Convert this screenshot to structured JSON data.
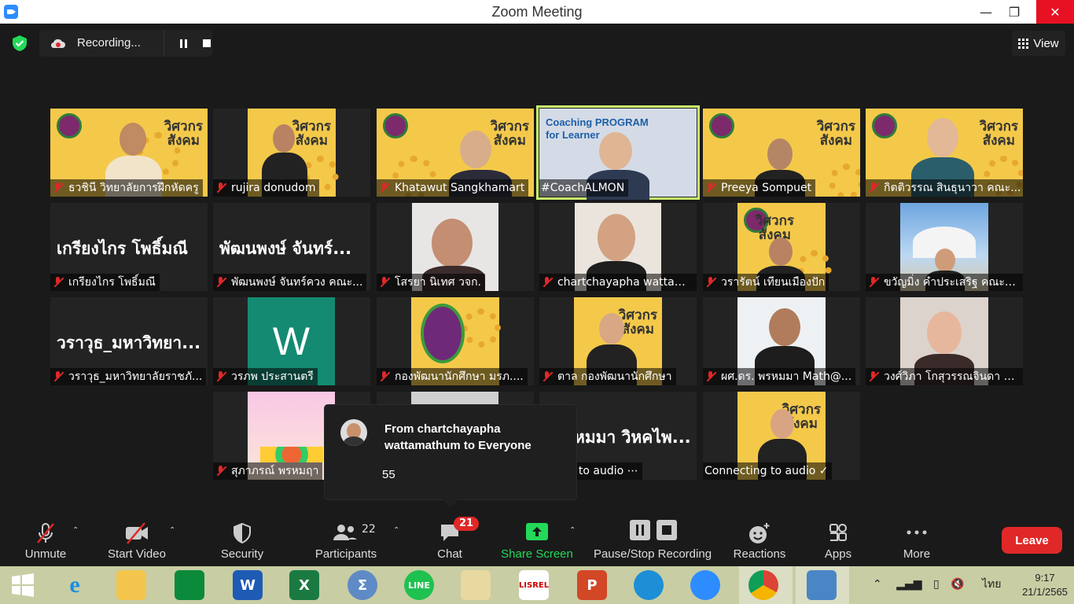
{
  "window": {
    "title": "Zoom Meeting",
    "minimize": "—",
    "maximize": "❐",
    "close": "✕"
  },
  "topbar": {
    "recording_label": "Recording...",
    "view_label": "View"
  },
  "participants": [
    {
      "name": "ธวชินี วิทยาลัยการฝึกหัดครู",
      "banner_text": "วิศวกร\nสังคม"
    },
    {
      "name": "rujira donudom",
      "banner_text": "วิศวกร\nสังคม"
    },
    {
      "name": "Khatawut Sangkhamart",
      "banner_text": "วิศวกร\nสังคม"
    },
    {
      "name": "#CoachALMON",
      "banner_text": "Coaching PROGRAM\nfor Learner"
    },
    {
      "name": "Preeya Sompuet",
      "banner_text": "วิศวกร\nสังคม"
    },
    {
      "name": "กิตติวรรณ สินธุนาวา คณะ...",
      "banner_text": "วิศวกร\nสังคม"
    },
    {
      "name": "เกรียงไกร โพธิ์มณี",
      "big_name": "เกรียงไกร โพธิ์มณี"
    },
    {
      "name": "พัฒนพงษ์ จันทร์ควง คณะ...",
      "big_name": "พัฒนพงษ์ จันทร์..."
    },
    {
      "name": "โสรยา นิเทศ วจก."
    },
    {
      "name": "chartchayapha wattam..."
    },
    {
      "name": "วรารัตน์ เทียนเมืองปัก",
      "banner_text": "วิศวกร\nสังคม"
    },
    {
      "name": "ขวัญมิ่ง คำประเสริฐ คณะวิ..."
    },
    {
      "name": "วราวุธ_มหาวิทยาลัยราชภั...",
      "big_name": "วราวุธ_มหาวิทยา..."
    },
    {
      "name": "วรภพ ประสานตรี",
      "letter": "W"
    },
    {
      "name": "กองพัฒนานักศึกษา มรภ....",
      "banner_text": "วิศวกร\nสังคม"
    },
    {
      "name": "ตาล กองพัฒนานักศึกษา",
      "banner_text": "วิศวกร\nสังคม"
    },
    {
      "name": "ผศ.ดร. พรหมมา Math@..."
    },
    {
      "name": "วงศ์วิภา โกสุวรรณจินดา ค..."
    },
    {
      "name": "สุภาภรณ์ พรหมฤา"
    },
    {
      "name": ""
    },
    {
      "name": "ecting to audio ⋯",
      "big_name": "หมมา วิหคไพ..."
    },
    {
      "name": "Connecting to audio ✓",
      "banner_text": "วิศวกร\nสังคม"
    }
  ],
  "chat_popup": {
    "from": "From chartchayapha wattamathum to Everyone",
    "message": "55"
  },
  "controls": {
    "unmute": "Unmute",
    "start_video": "Start Video",
    "security": "Security",
    "participants": "Participants",
    "participants_count": "22",
    "chat": "Chat",
    "chat_badge": "21",
    "share_screen": "Share Screen",
    "pause_stop": "Pause/Stop Recording",
    "reactions": "Reactions",
    "apps": "Apps",
    "more": "More",
    "leave": "Leave"
  },
  "colors": {
    "share_green": "#23d959",
    "leave_red": "#e02828",
    "active_speaker": "#c9f36b"
  },
  "taskbar": {
    "apps": [
      "windows-start",
      "internet-explorer",
      "file-explorer",
      "store",
      "word",
      "excel",
      "calculator",
      "line",
      "paint",
      "lisrel",
      "powerpoint",
      "edge",
      "zoom",
      "chrome",
      "remote-desktop"
    ],
    "tray_language": "ไทย",
    "time": "9:17",
    "date": "21/1/2565"
  }
}
